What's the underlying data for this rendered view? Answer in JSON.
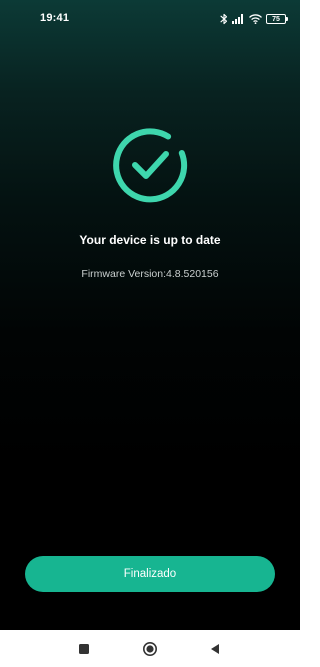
{
  "status_bar": {
    "time": "19:41",
    "battery_level": "75",
    "icons": [
      "bluetooth-icon",
      "signal-icon",
      "wifi-icon",
      "battery-icon"
    ]
  },
  "main": {
    "status_icon": "check-circle-icon",
    "headline": "Your device is up to date",
    "firmware_version": "Firmware Version:4.8.520156"
  },
  "actions": {
    "finish_label": "Finalizado"
  },
  "navigation": {
    "buttons": [
      "recent-apps-icon",
      "home-icon",
      "back-icon"
    ]
  },
  "colors": {
    "accent": "#17b591",
    "check": "#3ed6ad",
    "background_top": "#0c3a36",
    "background_bottom": "#000000"
  }
}
